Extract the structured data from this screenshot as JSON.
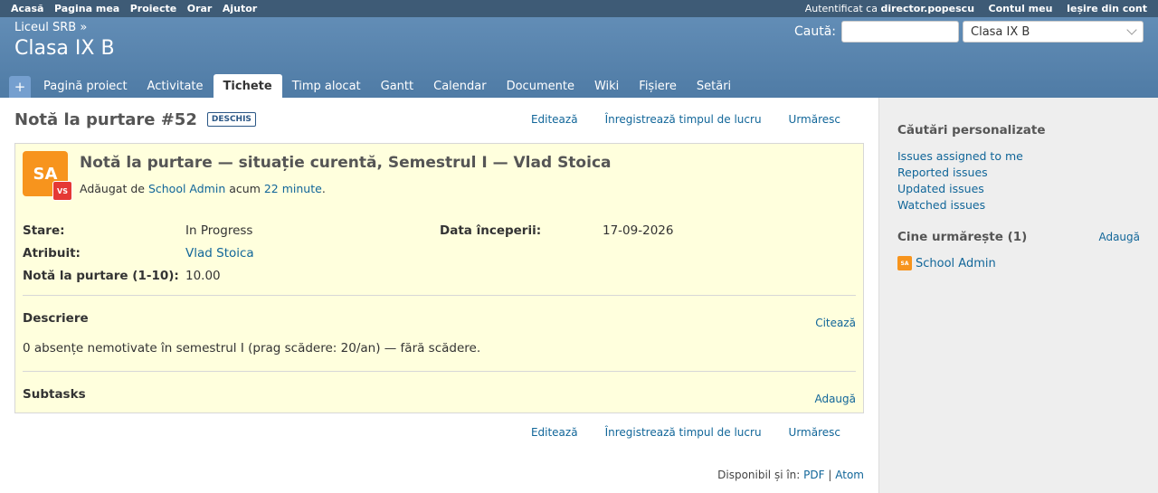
{
  "top_menu": {
    "left": [
      "Acasă",
      "Pagina mea",
      "Proiecte",
      "Orar",
      "Ajutor"
    ],
    "logged_prefix": "Autentificat ca",
    "username": "director.popescu",
    "account": "Contul meu",
    "logout": "Ieșire din cont"
  },
  "header": {
    "parent": "Liceul SRB »",
    "title": "Clasa IX B",
    "search_label": "Caută:",
    "search_value": "",
    "project_select": "Clasa IX B"
  },
  "main_menu": {
    "plus": "+",
    "tabs": [
      "Pagină proiect",
      "Activitate",
      "Tichete",
      "Timp alocat",
      "Gantt",
      "Calendar",
      "Documente",
      "Wiki",
      "Fișiere",
      "Setări"
    ],
    "selected": "Tichete"
  },
  "issue": {
    "heading": "Notă la purtare #52",
    "status_badge": "DESCHIS",
    "actions": {
      "edit": "Editează",
      "log_time": "Înregistrează timpul de lucru",
      "watch": "Urmăresc"
    },
    "avatar_initials": "SA",
    "assignee_initials": "VS",
    "subject": "Notă la purtare — situație curentă, Semestrul I — Vlad Stoica",
    "added_by": "Adăugat de",
    "author": "School Admin",
    "ago_prefix": "acum",
    "ago": "22 minute",
    "ago_suffix": ".",
    "attributes": {
      "status_label": "Stare:",
      "status_value": "In Progress",
      "start_label": "Data începerii:",
      "start_value": "17-09-2026",
      "assignee_label": "Atribuit:",
      "assignee_value": "Vlad Stoica",
      "grade_label": "Notă la purtare (1-10):",
      "grade_value": "10.00"
    },
    "description_title": "Descriere",
    "quote": "Citează",
    "description": "0 absențe nemotivate în semestrul I (prag scădere: 20/an) — fără scădere.",
    "subtasks_title": "Subtasks",
    "subtasks_add": "Adaugă"
  },
  "other_formats": {
    "label": "Disponibil și în:",
    "pdf": "PDF",
    "separator": "|",
    "atom": "Atom"
  },
  "sidebar": {
    "queries_title": "Căutări personalizate",
    "queries": [
      "Issues assigned to me",
      "Reported issues",
      "Updated issues",
      "Watched issues"
    ],
    "watchers_title": "Cine urmărește (1)",
    "watchers_add": "Adaugă",
    "watcher_initials": "SA",
    "watcher_name": "School Admin"
  }
}
